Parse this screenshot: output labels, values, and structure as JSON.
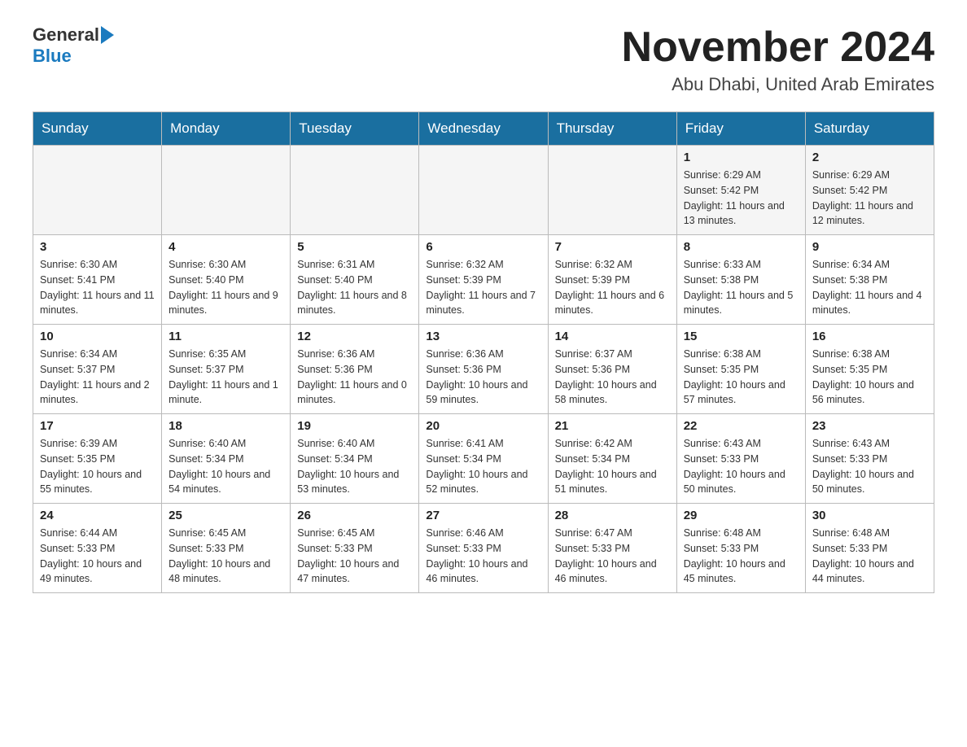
{
  "header": {
    "logo_general": "General",
    "logo_blue": "Blue",
    "month_title": "November 2024",
    "location": "Abu Dhabi, United Arab Emirates"
  },
  "weekdays": [
    "Sunday",
    "Monday",
    "Tuesday",
    "Wednesday",
    "Thursday",
    "Friday",
    "Saturday"
  ],
  "weeks": [
    [
      {
        "day": "",
        "sunrise": "",
        "sunset": "",
        "daylight": ""
      },
      {
        "day": "",
        "sunrise": "",
        "sunset": "",
        "daylight": ""
      },
      {
        "day": "",
        "sunrise": "",
        "sunset": "",
        "daylight": ""
      },
      {
        "day": "",
        "sunrise": "",
        "sunset": "",
        "daylight": ""
      },
      {
        "day": "",
        "sunrise": "",
        "sunset": "",
        "daylight": ""
      },
      {
        "day": "1",
        "sunrise": "Sunrise: 6:29 AM",
        "sunset": "Sunset: 5:42 PM",
        "daylight": "Daylight: 11 hours and 13 minutes."
      },
      {
        "day": "2",
        "sunrise": "Sunrise: 6:29 AM",
        "sunset": "Sunset: 5:42 PM",
        "daylight": "Daylight: 11 hours and 12 minutes."
      }
    ],
    [
      {
        "day": "3",
        "sunrise": "Sunrise: 6:30 AM",
        "sunset": "Sunset: 5:41 PM",
        "daylight": "Daylight: 11 hours and 11 minutes."
      },
      {
        "day": "4",
        "sunrise": "Sunrise: 6:30 AM",
        "sunset": "Sunset: 5:40 PM",
        "daylight": "Daylight: 11 hours and 9 minutes."
      },
      {
        "day": "5",
        "sunrise": "Sunrise: 6:31 AM",
        "sunset": "Sunset: 5:40 PM",
        "daylight": "Daylight: 11 hours and 8 minutes."
      },
      {
        "day": "6",
        "sunrise": "Sunrise: 6:32 AM",
        "sunset": "Sunset: 5:39 PM",
        "daylight": "Daylight: 11 hours and 7 minutes."
      },
      {
        "day": "7",
        "sunrise": "Sunrise: 6:32 AM",
        "sunset": "Sunset: 5:39 PM",
        "daylight": "Daylight: 11 hours and 6 minutes."
      },
      {
        "day": "8",
        "sunrise": "Sunrise: 6:33 AM",
        "sunset": "Sunset: 5:38 PM",
        "daylight": "Daylight: 11 hours and 5 minutes."
      },
      {
        "day": "9",
        "sunrise": "Sunrise: 6:34 AM",
        "sunset": "Sunset: 5:38 PM",
        "daylight": "Daylight: 11 hours and 4 minutes."
      }
    ],
    [
      {
        "day": "10",
        "sunrise": "Sunrise: 6:34 AM",
        "sunset": "Sunset: 5:37 PM",
        "daylight": "Daylight: 11 hours and 2 minutes."
      },
      {
        "day": "11",
        "sunrise": "Sunrise: 6:35 AM",
        "sunset": "Sunset: 5:37 PM",
        "daylight": "Daylight: 11 hours and 1 minute."
      },
      {
        "day": "12",
        "sunrise": "Sunrise: 6:36 AM",
        "sunset": "Sunset: 5:36 PM",
        "daylight": "Daylight: 11 hours and 0 minutes."
      },
      {
        "day": "13",
        "sunrise": "Sunrise: 6:36 AM",
        "sunset": "Sunset: 5:36 PM",
        "daylight": "Daylight: 10 hours and 59 minutes."
      },
      {
        "day": "14",
        "sunrise": "Sunrise: 6:37 AM",
        "sunset": "Sunset: 5:36 PM",
        "daylight": "Daylight: 10 hours and 58 minutes."
      },
      {
        "day": "15",
        "sunrise": "Sunrise: 6:38 AM",
        "sunset": "Sunset: 5:35 PM",
        "daylight": "Daylight: 10 hours and 57 minutes."
      },
      {
        "day": "16",
        "sunrise": "Sunrise: 6:38 AM",
        "sunset": "Sunset: 5:35 PM",
        "daylight": "Daylight: 10 hours and 56 minutes."
      }
    ],
    [
      {
        "day": "17",
        "sunrise": "Sunrise: 6:39 AM",
        "sunset": "Sunset: 5:35 PM",
        "daylight": "Daylight: 10 hours and 55 minutes."
      },
      {
        "day": "18",
        "sunrise": "Sunrise: 6:40 AM",
        "sunset": "Sunset: 5:34 PM",
        "daylight": "Daylight: 10 hours and 54 minutes."
      },
      {
        "day": "19",
        "sunrise": "Sunrise: 6:40 AM",
        "sunset": "Sunset: 5:34 PM",
        "daylight": "Daylight: 10 hours and 53 minutes."
      },
      {
        "day": "20",
        "sunrise": "Sunrise: 6:41 AM",
        "sunset": "Sunset: 5:34 PM",
        "daylight": "Daylight: 10 hours and 52 minutes."
      },
      {
        "day": "21",
        "sunrise": "Sunrise: 6:42 AM",
        "sunset": "Sunset: 5:34 PM",
        "daylight": "Daylight: 10 hours and 51 minutes."
      },
      {
        "day": "22",
        "sunrise": "Sunrise: 6:43 AM",
        "sunset": "Sunset: 5:33 PM",
        "daylight": "Daylight: 10 hours and 50 minutes."
      },
      {
        "day": "23",
        "sunrise": "Sunrise: 6:43 AM",
        "sunset": "Sunset: 5:33 PM",
        "daylight": "Daylight: 10 hours and 50 minutes."
      }
    ],
    [
      {
        "day": "24",
        "sunrise": "Sunrise: 6:44 AM",
        "sunset": "Sunset: 5:33 PM",
        "daylight": "Daylight: 10 hours and 49 minutes."
      },
      {
        "day": "25",
        "sunrise": "Sunrise: 6:45 AM",
        "sunset": "Sunset: 5:33 PM",
        "daylight": "Daylight: 10 hours and 48 minutes."
      },
      {
        "day": "26",
        "sunrise": "Sunrise: 6:45 AM",
        "sunset": "Sunset: 5:33 PM",
        "daylight": "Daylight: 10 hours and 47 minutes."
      },
      {
        "day": "27",
        "sunrise": "Sunrise: 6:46 AM",
        "sunset": "Sunset: 5:33 PM",
        "daylight": "Daylight: 10 hours and 46 minutes."
      },
      {
        "day": "28",
        "sunrise": "Sunrise: 6:47 AM",
        "sunset": "Sunset: 5:33 PM",
        "daylight": "Daylight: 10 hours and 46 minutes."
      },
      {
        "day": "29",
        "sunrise": "Sunrise: 6:48 AM",
        "sunset": "Sunset: 5:33 PM",
        "daylight": "Daylight: 10 hours and 45 minutes."
      },
      {
        "day": "30",
        "sunrise": "Sunrise: 6:48 AM",
        "sunset": "Sunset: 5:33 PM",
        "daylight": "Daylight: 10 hours and 44 minutes."
      }
    ]
  ]
}
